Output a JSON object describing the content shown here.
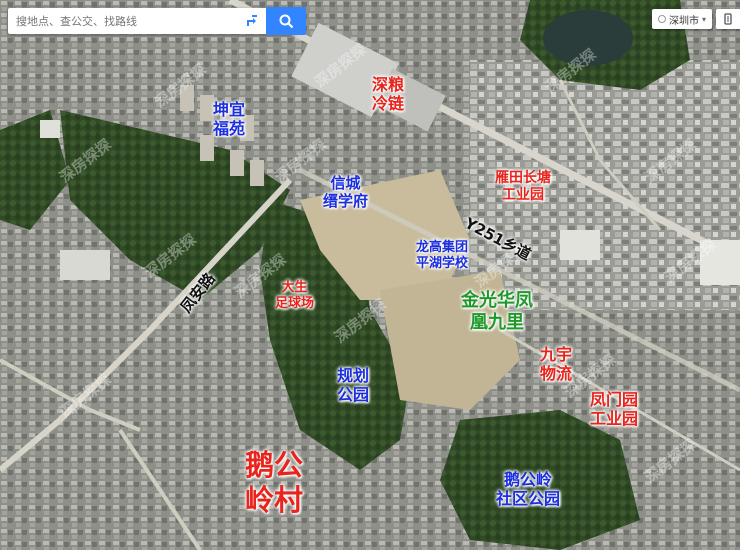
{
  "search": {
    "placeholder": "搜地点、查公交、找路线"
  },
  "city": {
    "name": "深圳市"
  },
  "watermark": "深房探探",
  "roads": [
    {
      "id": "fengan",
      "name": "凤安路"
    },
    {
      "id": "y251",
      "name": "Y251乡道"
    }
  ],
  "places": [
    {
      "id": "kunyi",
      "name": "坤宜\n福苑",
      "color": "blue"
    },
    {
      "id": "shenliang",
      "name": "深粮\n冷链",
      "color": "red"
    },
    {
      "id": "xincheng",
      "name": "信城\n缙学府",
      "color": "blue"
    },
    {
      "id": "yantian",
      "name": "雁田长塘\n工业园",
      "color": "red"
    },
    {
      "id": "longgao",
      "name": "龙高集团\n平湖学校",
      "color": "blue"
    },
    {
      "id": "dasheng",
      "name": "大生\n足球场",
      "color": "red"
    },
    {
      "id": "jinguang",
      "name": "金光华凤\n凰九里",
      "color": "green"
    },
    {
      "id": "guihua",
      "name": "规划\n公园",
      "color": "blue"
    },
    {
      "id": "jiuyu",
      "name": "九宇\n物流",
      "color": "red"
    },
    {
      "id": "fengmen",
      "name": "凤门园\n工业园",
      "color": "red"
    },
    {
      "id": "egongling-village",
      "name": "鹅公\n岭村",
      "color": "red"
    },
    {
      "id": "egongling-park",
      "name": "鹅公岭\n社区公园",
      "color": "blue"
    }
  ],
  "colors": {
    "accent": "#3385ff",
    "blue_label": "#1b2ee0",
    "red_label": "#e8241c",
    "green_label": "#1f9a2a"
  }
}
